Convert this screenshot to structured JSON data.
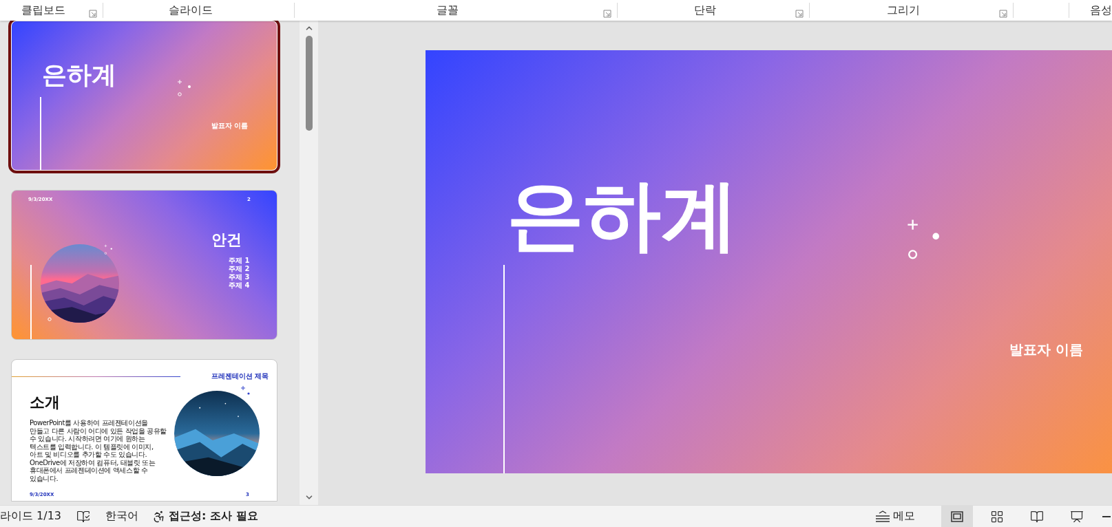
{
  "ribbon_groups": [
    {
      "label": "클립보드",
      "launcher": true
    },
    {
      "label": "슬라이드",
      "launcher": false
    },
    {
      "label": "글꼴",
      "launcher": true
    },
    {
      "label": "단락",
      "launcher": true
    },
    {
      "label": "그리기",
      "launcher": true
    },
    {
      "label": "음성",
      "launcher": false
    }
  ],
  "slides": [
    {
      "kind": "title",
      "selected": true,
      "title": "은하계",
      "subtitle": "발표자 이름"
    },
    {
      "kind": "agenda",
      "selected": false,
      "date": "9/3/20XX",
      "number": "2",
      "title": "안건",
      "topics": [
        "주제 1",
        "주제 2",
        "주제 3",
        "주제 4"
      ]
    },
    {
      "kind": "intro",
      "selected": false,
      "header": "프레젠테이션 제목",
      "title": "소개",
      "body": "PowerPoint를 사용하여 프레젠테이션을 만들고 다른 사람이 어디에 있든 작업을 공유할 수 있습니다. 시작하려면 여기에 원하는 텍스트를 입력합니다. 이 템플릿에 이미지, 아트 및 비디오를 추가할 수도 있습니다. OneDrive에 저장하여 컴퓨터, 태블릿 또는 휴대폰에서 프레젠테이션에 액세스할 수 있습니다.",
      "date": "9/3/20XX",
      "number": "3"
    }
  ],
  "main_slide": {
    "title": "은하계",
    "subtitle": "발표자 이름"
  },
  "status_bar": {
    "slide_counter": "라이드 1/13",
    "language": "한국어",
    "accessibility": "접근성: 조사 필요",
    "notes": "메모",
    "views": [
      {
        "kind": "normal",
        "selected": true
      },
      {
        "kind": "sorter",
        "selected": false
      },
      {
        "kind": "reading",
        "selected": false
      },
      {
        "kind": "slideshow",
        "selected": false
      }
    ]
  }
}
